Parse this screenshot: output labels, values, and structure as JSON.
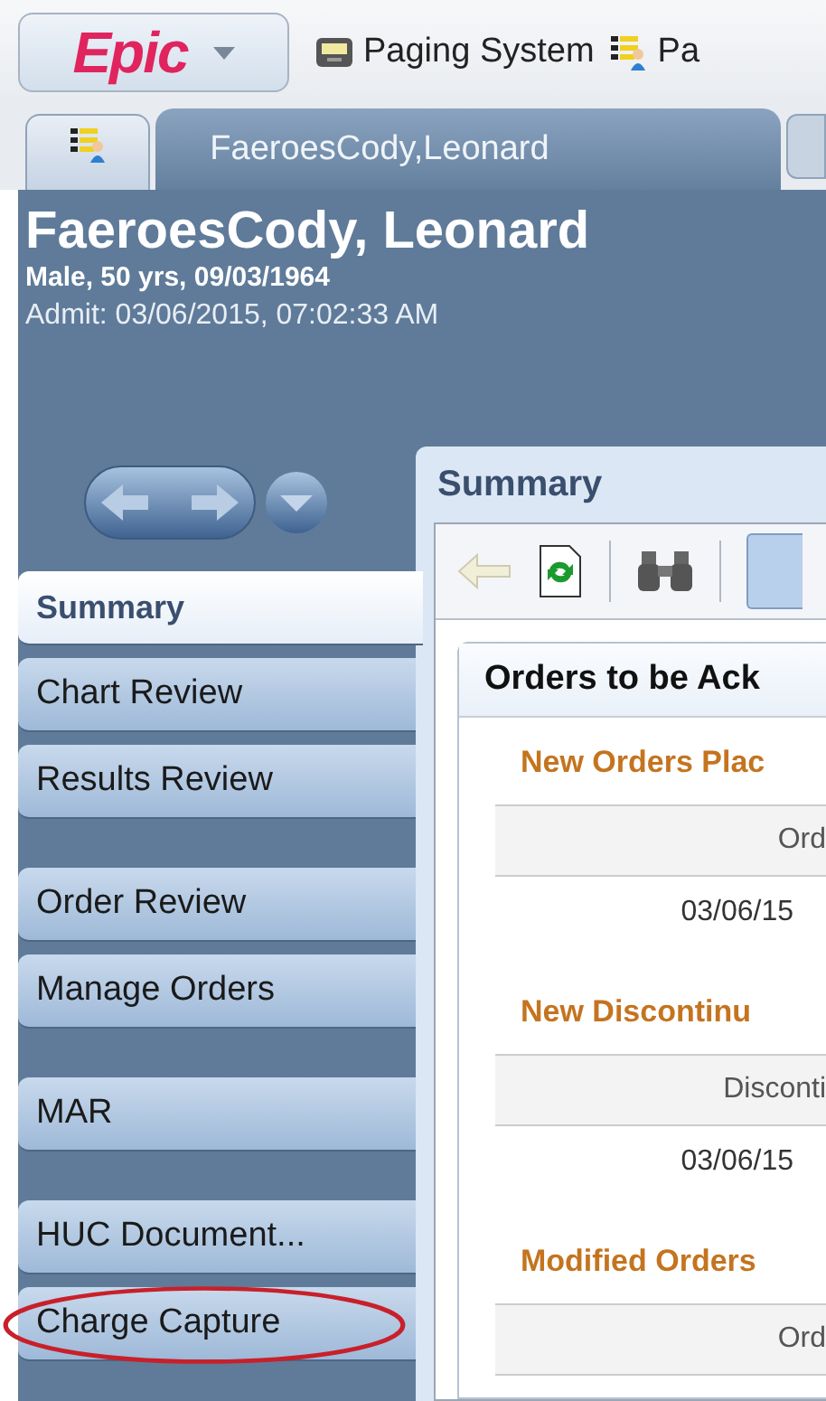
{
  "toolbar": {
    "app_menu": "Epic",
    "items": [
      {
        "label": "Paging System",
        "kind": "pager"
      },
      {
        "label": "Pa",
        "kind": "patient"
      }
    ]
  },
  "tabs": [
    {
      "label": "FaeroesCody,Leonard",
      "selected": true
    }
  ],
  "patient": {
    "name": "FaeroesCody, Leonard",
    "demographics": "Male, 50 yrs, 09/03/1964",
    "admit": "Admit: 03/06/2015, 07:02:33 AM"
  },
  "sidebar": {
    "items": [
      {
        "label": "Summary",
        "selected": true,
        "gap_before": false,
        "highlighted": false
      },
      {
        "label": "Chart Review",
        "selected": false,
        "gap_before": false,
        "highlighted": false
      },
      {
        "label": "Results Review",
        "selected": false,
        "gap_before": false,
        "highlighted": false
      },
      {
        "label": "Order Review",
        "selected": false,
        "gap_before": true,
        "highlighted": false
      },
      {
        "label": "Manage Orders",
        "selected": false,
        "gap_before": false,
        "highlighted": false
      },
      {
        "label": "MAR",
        "selected": false,
        "gap_before": true,
        "highlighted": false
      },
      {
        "label": "HUC Document...",
        "selected": false,
        "gap_before": true,
        "highlighted": false
      },
      {
        "label": "Charge Capture",
        "selected": false,
        "gap_before": false,
        "highlighted": true
      }
    ]
  },
  "panel": {
    "title": "Summary",
    "section": {
      "title": "Orders to be Ack",
      "groups": [
        {
          "title": "New Orders Plac",
          "column": "Ord",
          "rows": [
            "03/06/15"
          ]
        },
        {
          "title": "New Discontinu",
          "column": "Disconti",
          "rows": [
            "03/06/15"
          ]
        },
        {
          "title": "Modified Orders",
          "column": "Ord"
        }
      ]
    }
  }
}
